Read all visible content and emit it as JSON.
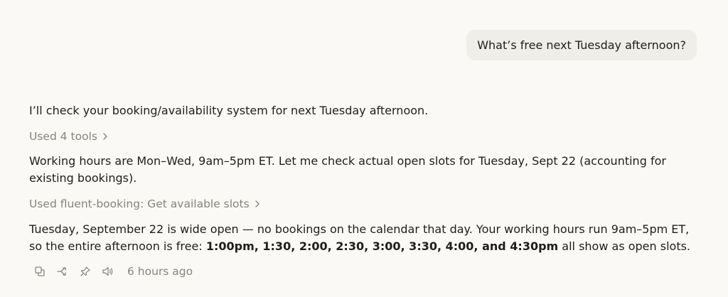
{
  "conversation": {
    "user_message": "What’s free next Tuesday afternoon?",
    "assistant": {
      "intro": "I’ll check your booking/availability system for next Tuesday afternoon.",
      "tool_summary_1": "Used 4 tools",
      "working_hours": "Working hours are Mon–Wed, 9am–5pm ET. Let me check actual open slots for Tuesday, Sept 22 (accounting for existing bookings).",
      "tool_summary_2": "Used fluent-booking: Get available slots",
      "answer_prefix": "Tuesday, September 22 is wide open — no bookings on the calendar that day. Your working hours run 9am–5pm ET, so the entire afternoon is free: ",
      "answer_slots": "1:00pm, 1:30, 2:00, 2:30, 3:00, 3:30, 4:00, and 4:30pm",
      "answer_suffix": " all show as open slots."
    },
    "actions": {
      "icons": [
        "copy-icon",
        "branch-icon",
        "pin-icon",
        "speaker-icon"
      ],
      "timestamp": "6 hours ago"
    }
  },
  "colors": {
    "background": "#faf9f5",
    "user_bubble": "#efeee9",
    "text": "#1f1e1b",
    "muted": "#86847c"
  }
}
